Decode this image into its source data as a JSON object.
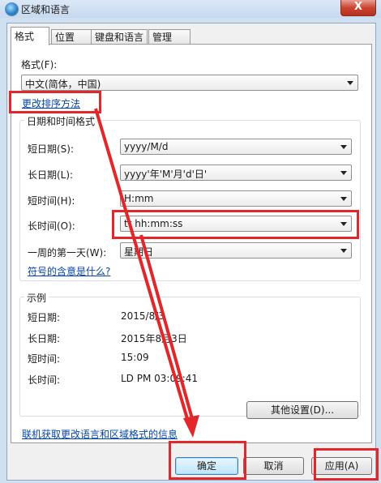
{
  "window": {
    "title": "区域和语言",
    "close_glyph": "X"
  },
  "tabs": [
    {
      "label": "格式",
      "active": true
    },
    {
      "label": "位置",
      "active": false
    },
    {
      "label": "键盘和语言",
      "active": false
    },
    {
      "label": "管理",
      "active": false
    }
  ],
  "format": {
    "label": "格式(F):",
    "value": "中文(简体，中国)",
    "change_sort_link": "更改排序方法"
  },
  "datetime": {
    "group_title": "日期和时间格式",
    "short_date": {
      "label": "短日期(S):",
      "value": "yyyy/M/d"
    },
    "long_date": {
      "label": "长日期(L):",
      "value": "yyyy'年'M'月'd'日'"
    },
    "short_time": {
      "label": "短时间(H):",
      "value": "H:mm"
    },
    "long_time": {
      "label": "长时间(O):",
      "value": "tt hh:mm:ss"
    },
    "first_day": {
      "label": "一周的第一天(W):",
      "value": "星期日"
    },
    "symbols_link": "符号的含意是什么?"
  },
  "example": {
    "group_title": "示例",
    "short_date": {
      "label": "短日期:",
      "value": "2015/8/3"
    },
    "long_date": {
      "label": "长日期:",
      "value": "2015年8月3日"
    },
    "short_time": {
      "label": "短时间:",
      "value": "15:09"
    },
    "long_time": {
      "label": "长时间:",
      "value": "LD PM 03:09:41"
    }
  },
  "other_settings_button": "其他设置(D)...",
  "online_link": "联机获取更改语言和区域格式的信息",
  "buttons": {
    "ok": "确定",
    "cancel": "取消",
    "apply": "应用(A)"
  },
  "colors": {
    "annotation_red": "#e3262a",
    "link_blue": "#0645ad"
  }
}
